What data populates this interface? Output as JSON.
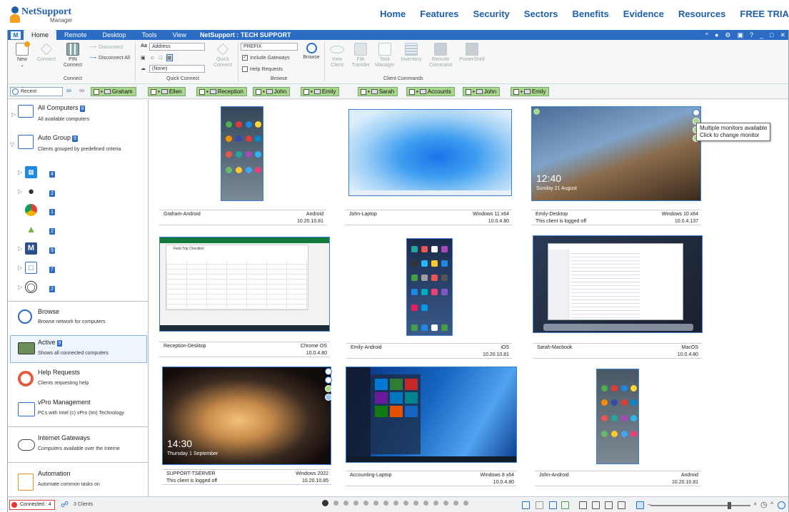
{
  "website": {
    "logo_name": "NetSupport",
    "logo_sub": "Manager",
    "nav": [
      "Home",
      "Features",
      "Security",
      "Sectors",
      "Benefits",
      "Evidence",
      "Resources",
      "FREE TRIA"
    ]
  },
  "app": {
    "tabs": [
      "Home",
      "Remote",
      "Desktop",
      "Tools",
      "View"
    ],
    "title": "NetSupport : TECH SUPPORT",
    "app_icon": "M"
  },
  "ribbon": {
    "new": "New",
    "connect": "Connect",
    "pin_connect": "PIN Connect",
    "disconnect": "Disconnect",
    "disconnect_all": "Disconnect All",
    "group_connect": "Connect",
    "address_value": "Address",
    "none_value": "(None)",
    "quick_connect": "Quick Connect",
    "group_quick_connect": "Quick Connect",
    "prefix_value": "PREFIX",
    "include_gateways": "Include Gateways",
    "help_requests": "Help Requests",
    "browse": "Browse",
    "group_browse": "Browse",
    "view_client": "View Client",
    "file_transfer": "File Transfer",
    "task_manager": "Task Manager",
    "inventory": "Inventory",
    "remote_command": "Remote Command",
    "powershell": "PowerShell",
    "group_client_commands": "Client Commands"
  },
  "quickbar": {
    "recent": "Recent",
    "items": [
      "Graham",
      "Ellen",
      "Reception",
      "John",
      "Emily",
      "Sarah",
      "Accounts",
      "John",
      "Emily"
    ]
  },
  "left": {
    "all_title": "All Computers",
    "all_count": "9",
    "all_sub": "All available computers",
    "auto_title": "Auto Group",
    "auto_count": "9",
    "auto_sub": "Clients grouped by predefined criteria",
    "os": [
      {
        "icon": "windows-icon",
        "count": "4"
      },
      {
        "icon": "apple-icon",
        "count": "2"
      },
      {
        "icon": "chrome-icon",
        "count": "1"
      },
      {
        "icon": "android-icon",
        "count": "2"
      },
      {
        "icon": "netsupport-icon",
        "count": "9"
      },
      {
        "icon": "cube-icon",
        "count": "7"
      },
      {
        "icon": "globe-icon",
        "count": "2"
      }
    ],
    "browse_title": "Browse",
    "browse_sub": "Browse network for computers",
    "active_title": "Active",
    "active_count": "9",
    "active_sub": "Shows all connected computers",
    "help_title": "Help Requests",
    "help_sub": "Clients requesting help",
    "vpro_title": "vPro Management",
    "vpro_sub": "PCs with Intel (c) vPro (tm) Technology",
    "gateway_title": "Internet Gateways",
    "gateway_sub": "Computers available over the Interne",
    "auto2_title": "Automation",
    "auto2_sub": "Automate common tasks on"
  },
  "clients": [
    {
      "name": "Graham-Android",
      "os": "Android",
      "ip": "10.20.10.81",
      "status": ""
    },
    {
      "name": "John-Laptop",
      "os": "Windows 11 x64",
      "ip": "10.0.4.80",
      "status": ""
    },
    {
      "name": "Emily-Desktop",
      "os": "Windows 10 x64",
      "ip": "10.0.4.137",
      "status": "This client is logged off"
    },
    {
      "name": "Reception-Desktop",
      "os": "Chrome OS",
      "ip": "10.0.4.80",
      "status": ""
    },
    {
      "name": "Emily-Android",
      "os": "iOS",
      "ip": "10.20.10.81",
      "status": ""
    },
    {
      "name": "Sarah-Macbook",
      "os": "MacOS",
      "ip": "10.0.4.80",
      "status": ""
    },
    {
      "name": "SUPPORT-TSERVER",
      "os": "Windows 2022",
      "ip": "10.20.10.85",
      "status": "This client is logged off"
    },
    {
      "name": "Accounting-Laptop",
      "os": "Windows 8 x64",
      "ip": "10.0.4.80",
      "status": ""
    },
    {
      "name": "John-Android",
      "os": "Android",
      "ip": "10.20.10.81",
      "status": ""
    }
  ],
  "screens": {
    "emily_time": "12:40",
    "emily_date": "Sunday 21 August",
    "tserver_time": "14:30",
    "tserver_date": "Thursday 1 September",
    "sheet_title": "Field Trip Checklist"
  },
  "tooltip": {
    "line1": "Multiple monitors available",
    "line2": "Click to change monitor"
  },
  "status": {
    "connected": "Connected : 4",
    "clients": "3 Clients"
  },
  "colors": {
    "accent": "#2b6cc4",
    "quick_green": "#a9d88d"
  }
}
